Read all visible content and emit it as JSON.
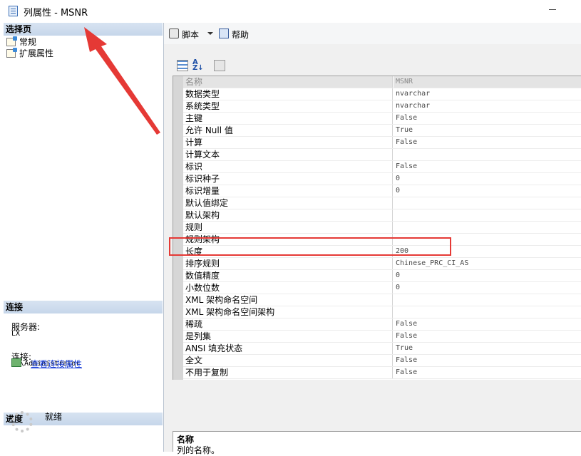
{
  "window": {
    "title": "列属性 - MSNR"
  },
  "left_pane": {
    "select_page": {
      "header": "选择页",
      "items": [
        {
          "label": "常规",
          "icon": "property-page-icon"
        },
        {
          "label": "扩展属性",
          "icon": "property-page-icon"
        }
      ]
    },
    "connection": {
      "header": "连接",
      "server_label": "服务器:",
      "server_value": "LX",
      "connection_label": "连接:",
      "connection_value": "LX\\Administrator",
      "view_link": "查看连接属性"
    },
    "progress": {
      "header": "进度",
      "status": "就绪"
    }
  },
  "toolbar": {
    "script_label": "脚本",
    "help_label": "帮助"
  },
  "properties": [
    {
      "name": "名称",
      "value": "MSNR",
      "selected": true
    },
    {
      "name": "数据类型",
      "value": "nvarchar"
    },
    {
      "name": "系统类型",
      "value": "nvarchar"
    },
    {
      "name": "主键",
      "value": "False"
    },
    {
      "name": "允许 Null 值",
      "value": "True"
    },
    {
      "name": "计算",
      "value": "False"
    },
    {
      "name": "计算文本",
      "value": ""
    },
    {
      "name": "标识",
      "value": "False"
    },
    {
      "name": "标识种子",
      "value": "0"
    },
    {
      "name": "标识增量",
      "value": "0"
    },
    {
      "name": "默认值绑定",
      "value": ""
    },
    {
      "name": "默认架构",
      "value": ""
    },
    {
      "name": "规则",
      "value": ""
    },
    {
      "name": "规则架构",
      "value": ""
    },
    {
      "name": "长度",
      "value": "200"
    },
    {
      "name": "排序规则",
      "value": "Chinese_PRC_CI_AS"
    },
    {
      "name": "数值精度",
      "value": "0"
    },
    {
      "name": "小数位数",
      "value": "0"
    },
    {
      "name": "XML 架构命名空间",
      "value": ""
    },
    {
      "name": "XML 架构命名空间架构",
      "value": ""
    },
    {
      "name": "稀疏",
      "value": "False"
    },
    {
      "name": "是列集",
      "value": "False"
    },
    {
      "name": "ANSI 填充状态",
      "value": "True"
    },
    {
      "name": "全文",
      "value": "False"
    },
    {
      "name": "不用于复制",
      "value": "False"
    }
  ],
  "description": {
    "title": "名称",
    "text": "列的名称。"
  },
  "annotations": {
    "highlight_color": "#e53935",
    "arrow_color": "#e53935"
  }
}
